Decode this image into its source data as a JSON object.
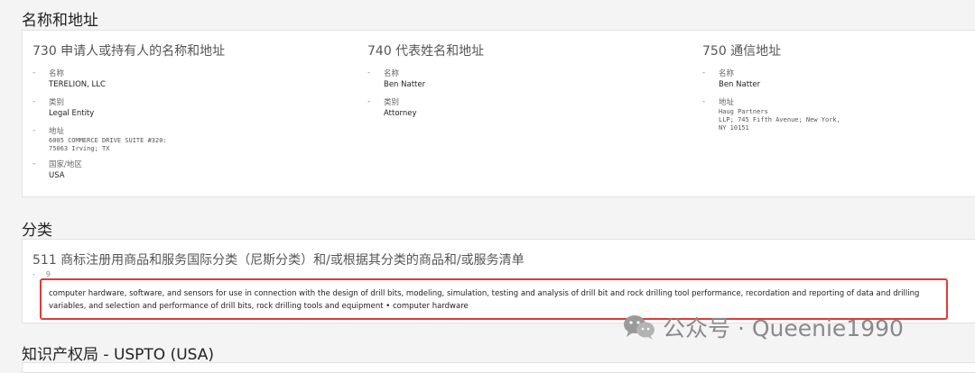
{
  "sections": {
    "name_address": {
      "title": "名称和地址",
      "applicant": {
        "title": "730 申请人或持有人的名称和地址",
        "name_label": "名称",
        "name_value": "TERELION, LLC",
        "type_label": "类别",
        "type_value": "Legal Entity",
        "address_label": "地址",
        "address_line1": "6005 COMMERCE DRIVE SUITE #320:",
        "address_line2": "75063 Irving; TX",
        "country_label": "国家/地区",
        "country_value": "USA"
      },
      "representative": {
        "title": "740 代表姓名和地址",
        "name_label": "名称",
        "name_value": "Ben Natter",
        "type_label": "类别",
        "type_value": "Attorney"
      },
      "correspondence": {
        "title": "750 通信地址",
        "name_label": "名称",
        "name_value": "Ben Natter",
        "address_label": "地址",
        "address_line1": "Haug Partners",
        "address_line2": "LLP; 745 Fifth Avenue; New York,",
        "address_line3": "NY 10151"
      }
    },
    "classification": {
      "title": "分类",
      "subtitle": "511 商标注册用商品和服务国际分类（尼斯分类）和/或根据其分类的商品和/或服务清单",
      "class_number": "9",
      "goods_services": "computer hardware, software, and sensors for use in connection with the design of drill bits, modeling, simulation, testing and analysis of drill bit and rock drilling tool performance, recordation and reporting of data and drilling variables, and selection and performance of drill bits, rock drilling tools and equipment • computer hardware"
    },
    "office": {
      "title": "知识产权局 - USPTO (USA)"
    }
  },
  "watermark": {
    "text": "公众号 · Queenie1990",
    "icon": "wechat-icon"
  },
  "colors": {
    "highlight_border": "#e53935",
    "page_background": "#f4f4f4"
  }
}
